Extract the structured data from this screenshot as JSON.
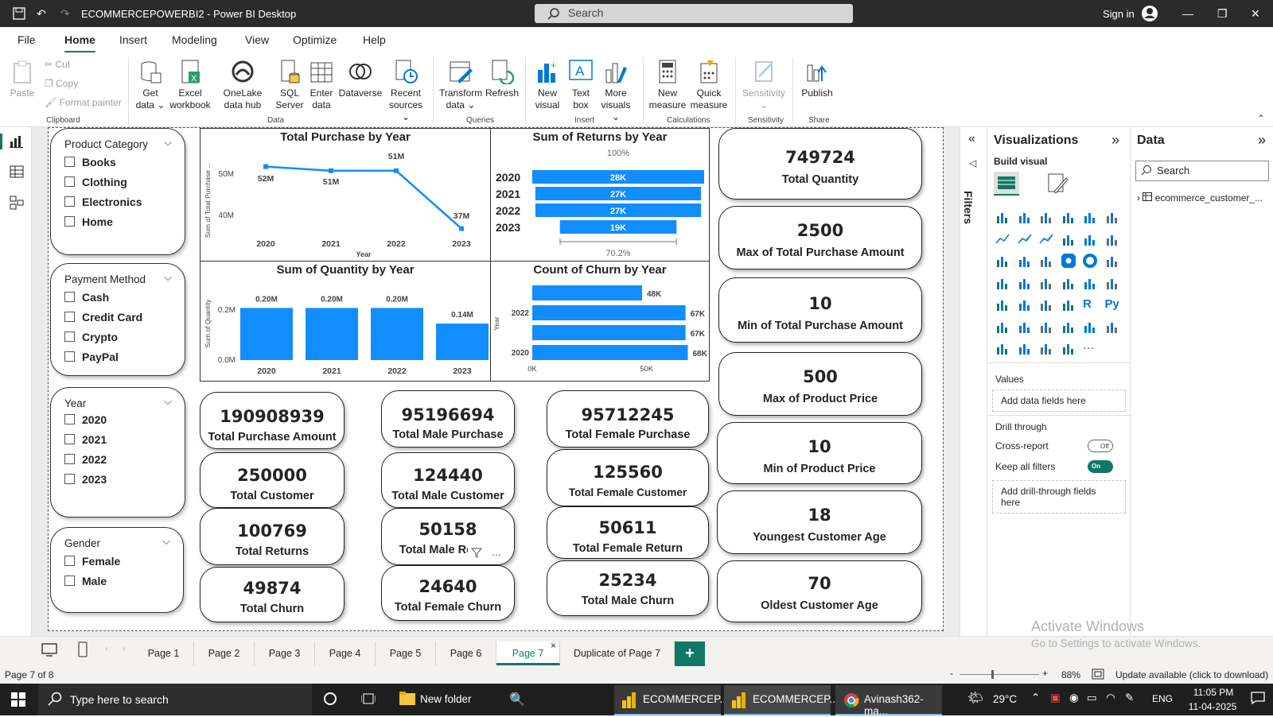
{
  "titlebar": {
    "title": "ECOMMERCEPOWERBI2 - Power BI Desktop",
    "search": "Search",
    "signin": "Sign in"
  },
  "menu": [
    "File",
    "Home",
    "Insert",
    "Modeling",
    "View",
    "Optimize",
    "Help"
  ],
  "menu_active": "Home",
  "ribbon": {
    "clipboard": {
      "paste": "Paste",
      "cut": "Cut",
      "copy": "Copy",
      "format_painter": "Format painter",
      "group": "Clipboard"
    },
    "data": {
      "get_data": "Get data",
      "excel": "Excel workbook",
      "onelake": "OneLake data hub",
      "sql": "SQL Server",
      "enter": "Enter data",
      "dataverse": "Dataverse",
      "recent": "Recent sources",
      "group": "Data"
    },
    "queries": {
      "transform": "Transform data",
      "refresh": "Refresh",
      "group": "Queries"
    },
    "insert": {
      "new_visual": "New visual",
      "text_box": "Text box",
      "more_visuals": "More visuals",
      "group": "Insert"
    },
    "calculations": {
      "new_measure": "New measure",
      "quick_measure": "Quick measure",
      "group": "Calculations"
    },
    "sensitivity": {
      "label": "Sensitivity",
      "group": "Sensitivity"
    },
    "share": {
      "publish": "Publish",
      "group": "Share"
    }
  },
  "slicers": [
    {
      "title": "Product Category",
      "options": [
        "Books",
        "Clothing",
        "Electronics",
        "Home"
      ]
    },
    {
      "title": "Payment Method",
      "options": [
        "Cash",
        "Credit Card",
        "Crypto",
        "PayPal"
      ]
    },
    {
      "title": "Year",
      "options": [
        "2020",
        "2021",
        "2022",
        "2023"
      ]
    },
    {
      "title": "Gender",
      "options": [
        "Female",
        "Male"
      ]
    }
  ],
  "chart_data": [
    {
      "type": "line",
      "title": "Total Purchase by Year",
      "xlabel": "Year",
      "ylabel": "Sum of Total Purchase ...",
      "categories": [
        "2020",
        "2021",
        "2022",
        "2023"
      ],
      "values": [
        52,
        51,
        51,
        37
      ],
      "value_labels": [
        "52M",
        "51M",
        "51M",
        "37M"
      ],
      "ytick_labels": [
        "50M",
        "40M"
      ],
      "unit": "M"
    },
    {
      "type": "bar",
      "orientation": "horizontal",
      "title": "Sum of Returns by Year",
      "categories": [
        "2020",
        "2021",
        "2022",
        "2023"
      ],
      "values": [
        28,
        27,
        27,
        19
      ],
      "value_labels": [
        "28K",
        "27K",
        "27K",
        "19K"
      ],
      "top_label": "100%",
      "bottom_label": "70.2%",
      "unit": "K"
    },
    {
      "type": "bar",
      "title": "Sum of Quantity by Year",
      "xlabel": "",
      "ylabel": "Sum of Quantity",
      "categories": [
        "2020",
        "2021",
        "2022",
        "2023"
      ],
      "values": [
        0.2,
        0.2,
        0.2,
        0.14
      ],
      "value_labels": [
        "0.20M",
        "0.20M",
        "0.20M",
        "0.14M"
      ],
      "ytick_labels": [
        "0.2M",
        "0.0M"
      ],
      "ylim": [
        0,
        0.25
      ]
    },
    {
      "type": "bar",
      "orientation": "horizontal",
      "title": "Count of Churn by Year",
      "ylabel": "Year",
      "categories": [
        "",
        "2022",
        "",
        "2020"
      ],
      "values": [
        48,
        67,
        67,
        68
      ],
      "value_labels": [
        "48K",
        "67K",
        "67K",
        "68K"
      ],
      "xtick_labels": [
        "0K",
        "50K"
      ],
      "xlim": [
        0,
        80
      ]
    }
  ],
  "cards_left": [
    {
      "value": "190908939",
      "label": "Total Purchase Amount"
    },
    {
      "value": "250000",
      "label": "Total Customer"
    },
    {
      "value": "100769",
      "label": "Total Returns"
    },
    {
      "value": "49874",
      "label": "Total Churn"
    }
  ],
  "cards_mid": [
    {
      "value": "95196694",
      "label": "Total Male Purchase"
    },
    {
      "value": "124440",
      "label": "Total Male Customer"
    },
    {
      "value": "50158",
      "label": "Total Male Re"
    },
    {
      "value": "24640",
      "label": "Total Female Churn"
    }
  ],
  "cards_mid2": [
    {
      "value": "95712245",
      "label": "Total Female Purchase"
    },
    {
      "value": "125560",
      "label": "Total Female Customer"
    },
    {
      "value": "50611",
      "label": "Total Female Return"
    },
    {
      "value": "25234",
      "label": "Total Male Churn"
    }
  ],
  "cards_right": [
    {
      "value": "749724",
      "label": "Total Quantity"
    },
    {
      "value": "2500",
      "label": "Max of Total Purchase Amount"
    },
    {
      "value": "10",
      "label": "Min of Total Purchase Amount"
    },
    {
      "value": "500",
      "label": "Max of Product Price"
    },
    {
      "value": "10",
      "label": "Min of Product Price"
    },
    {
      "value": "18",
      "label": "Youngest Customer Age"
    },
    {
      "value": "70",
      "label": "Oldest Customer Age"
    }
  ],
  "card_more": "...",
  "filters_label": "Filters",
  "visualizations": {
    "title": "Visualizations",
    "build": "Build visual",
    "values": "Values",
    "add_fields": "Add data fields here",
    "drill": "Drill through",
    "cross_report": "Cross-report",
    "cross_state": "Off",
    "keep_filters": "Keep all filters",
    "keep_state": "On",
    "add_drill": "Add drill-through fields here"
  },
  "data_pane": {
    "title": "Data",
    "search": "Search",
    "table": "ecommerce_customer_..."
  },
  "watermark": {
    "line1": "Activate Windows",
    "line2": "Go to Settings to activate Windows."
  },
  "tabs": [
    "Page 1",
    "Page 2",
    "Page 3",
    "Page 4",
    "Page 5",
    "Page 6",
    "Page 7",
    "Duplicate of Page 7"
  ],
  "active_tab": "Page 7",
  "tab_close": "×",
  "tab_add": "+",
  "status": {
    "page": "Page 7 of 8",
    "zoom": "88%",
    "update": "Update available (click to download)"
  },
  "taskbar": {
    "search": "Type here to search",
    "folder": "New folder",
    "app1": "ECOMMERCEP...",
    "app2": "ECOMMERCEP...",
    "chrome": "Avinash362-ma...",
    "temp": "29°C",
    "lang": "ENG",
    "time": "11:05 PM",
    "date": "11-04-2025"
  },
  "colors": {
    "accent": "#117865",
    "bar": "#118DFF",
    "titlebar": "#2b2b2b"
  }
}
